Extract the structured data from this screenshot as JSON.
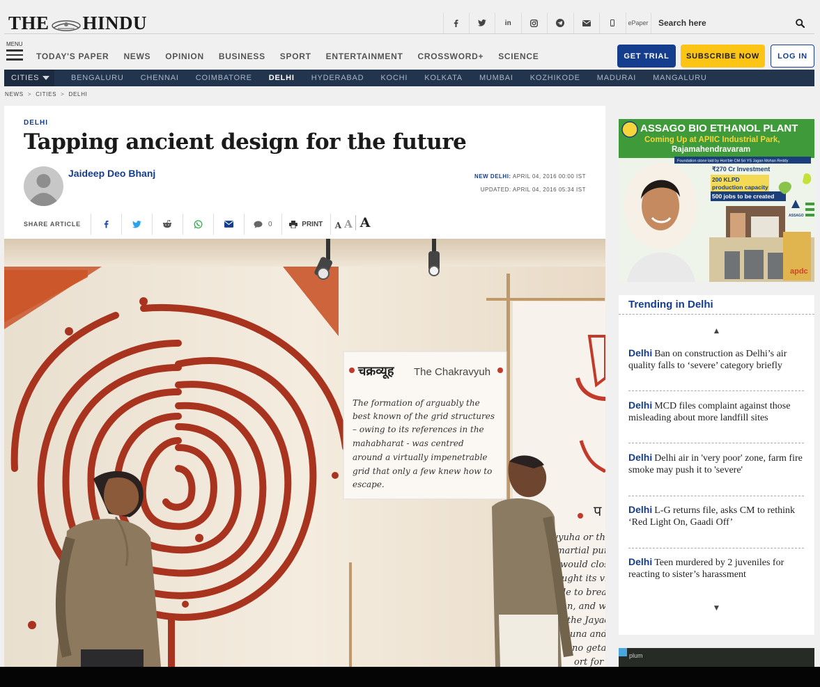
{
  "header": {
    "logo_left": "THE",
    "logo_right": "HINDU",
    "social": [
      "facebook-icon",
      "twitter-icon",
      "linkedin-icon",
      "instagram-icon",
      "telegram-icon",
      "email-icon",
      "mobile-icon"
    ],
    "epaper": "ePaper",
    "search_placeholder": "Search here"
  },
  "nav": {
    "menu_label": "MENU",
    "items": [
      "TODAY'S PAPER",
      "NEWS",
      "OPINION",
      "BUSINESS",
      "SPORT",
      "ENTERTAINMENT",
      "CROSSWORD+",
      "SCIENCE"
    ],
    "get_trial": "GET TRIAL",
    "subscribe": "SUBSCRIBE NOW",
    "login": "LOG IN"
  },
  "cities": {
    "dropdown": "CITIES",
    "items": [
      "BENGALURU",
      "CHENNAI",
      "COIMBATORE",
      "DELHI",
      "HYDERABAD",
      "KOCHI",
      "KOLKATA",
      "MUMBAI",
      "KOZHIKODE",
      "MADURAI",
      "MANGALURU"
    ],
    "active": "DELHI"
  },
  "breadcrumb": [
    "NEWS",
    "CITIES",
    "DELHI"
  ],
  "article": {
    "section": "DELHI",
    "headline": "Tapping ancient design for the future",
    "author": "Jaideep Deo Bhanj",
    "dateline_label": "NEW DELHI:",
    "published": "APRIL 04, 2016 00:00 IST",
    "updated": "UPDATED: APRIL 04, 2016 05:34 IST",
    "share_label": "SHARE ARTICLE",
    "comment_count": "0",
    "print_label": "PRINT",
    "font_sizes": [
      "A",
      "A",
      "A"
    ],
    "image": {
      "sign_hindi": "चक्रव्यूह",
      "sign_english": "The Chakravyuh",
      "sign_text": [
        "The formation of arguably the",
        "best known of the grid structures",
        "– owing to its references in the",
        "mahabharat - was centred",
        "around a virtually impenetrable",
        "grid that only a few knew how to",
        "escape."
      ],
      "right_text": [
        "avyuha or the",
        "r martial pur",
        "would close",
        "ught its vict",
        "le to break",
        "n, and was",
        "the Jayadra",
        "una and his",
        "no getaway",
        "ort for the"
      ],
      "right_hindi": "प"
    }
  },
  "sidebar": {
    "ad": {
      "title": "ASSAGO BIO ETHANOL PLANT",
      "subtitle": "Coming Up at APIIC Industrial Park,",
      "location": "Rajamahendravaram",
      "foundation": "Foundation stone laid by Hon'ble CM Sri YS Jagan Mohan Reddy",
      "investment": "₹270 Cr Investment",
      "capacity_1": "200 KLPD",
      "capacity_2": "production capacity",
      "jobs": "500 jobs to be created",
      "brand": "ASSAGO",
      "apdc": "apdc",
      "colors": {
        "green": "#3f9b3a",
        "yellow": "#f5d53a",
        "navy": "#1b3f7a"
      }
    },
    "trending_title": "Trending in Delhi",
    "trending": [
      {
        "city": "Delhi",
        "text": "Ban on construction as Delhi’s air quality falls to ‘severe’ category briefly"
      },
      {
        "city": "Delhi",
        "text": "MCD files complaint against those misleading about more landfill sites"
      },
      {
        "city": "Delhi",
        "text": "Delhi air in 'very poor' zone, farm fire smoke may push it to 'severe'"
      },
      {
        "city": "Delhi",
        "text": "L-G returns file, asks CM to rethink ‘Red Light On, Gaadi Off’"
      },
      {
        "city": "Delhi",
        "text": "Teen murdered by 2 juveniles for reacting to sister’s harassment"
      }
    ],
    "ad2_label": "plum"
  }
}
